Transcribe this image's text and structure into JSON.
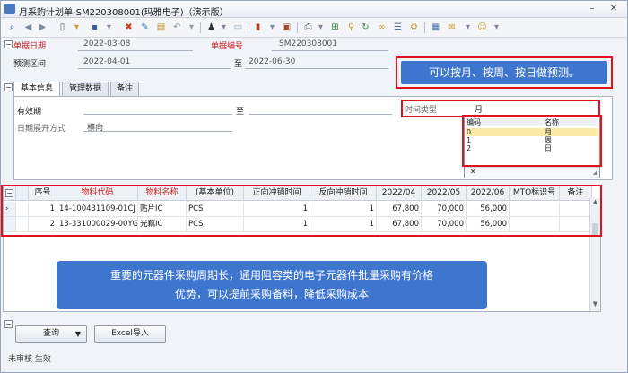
{
  "window": {
    "title": "月采购计划单-SM220308001(玛雅电子)（演示版）",
    "minimize": "–",
    "close": "✕"
  },
  "toolbar": {
    "icons": [
      "preview-icon",
      "back-icon",
      "forward-icon",
      "new-icon",
      "open-icon",
      "save-icon",
      "delete-icon",
      "edit-icon",
      "copy-icon",
      "undo-icon",
      "print-setup-icon",
      "approve-icon",
      "refresh-icon",
      "import-icon",
      "export-icon",
      "print-icon",
      "find-icon",
      "filter-icon",
      "link-icon",
      "tools-icon",
      "mail-icon",
      "chat-icon"
    ]
  },
  "header": {
    "doc_date_label": "单据日期",
    "doc_date_value": "2022-03-08",
    "doc_no_label": "单据编号",
    "doc_no_value": "SM220308001",
    "forecast_range_label": "预测区间",
    "forecast_from": "2022-04-01",
    "to_label": "至",
    "forecast_to": "2022-06-30"
  },
  "callout_top": "可以按月、按周、按日做预测。",
  "tabs": [
    {
      "label": "基本信息"
    },
    {
      "label": "管理数据"
    },
    {
      "label": "备注"
    }
  ],
  "basic": {
    "valid_label": "有效期",
    "to_label": "至",
    "expand_label": "日期展开方式",
    "expand_value": "横向",
    "time_type_label": "时间类型",
    "time_type_value": "月"
  },
  "dropdown": {
    "col_code": "编码",
    "col_name": "名称",
    "options": [
      {
        "code": "0",
        "name": "月"
      },
      {
        "code": "1",
        "name": "周"
      },
      {
        "code": "2",
        "name": "日"
      }
    ],
    "close": "✕"
  },
  "grid": {
    "columns": [
      "序号",
      "物料代码",
      "物料名称",
      "(基本单位)",
      "正向冲销时间",
      "反向冲销时间",
      "2022/04",
      "2022/05",
      "2022/06",
      "MTO标识号",
      "备注"
    ],
    "rows": [
      {
        "seq": "1",
        "code": "14-100431109-01CJ",
        "name": "贴片IC",
        "unit": "PCS",
        "fwd": "1",
        "rev": "1",
        "m04": "67,800",
        "m05": "70,000",
        "m06": "56,000",
        "mto": "",
        "note": ""
      },
      {
        "seq": "2",
        "code": "13-331000029-00YG",
        "name": "光藕IC",
        "unit": "PCS",
        "fwd": "1",
        "rev": "1",
        "m04": "67,800",
        "m05": "70,000",
        "m06": "56,000",
        "mto": "",
        "note": ""
      }
    ]
  },
  "callout_bottom": {
    "line1": "重要的元器件采购周期长，通用阻容类的电子元器件批量采购有价格",
    "line2": "优势，可以提前采购备料，降低采购成本"
  },
  "buttons": {
    "query": "查询",
    "query_arrow": "▼",
    "excel_import": "Excel导入"
  },
  "status": "未审核 生效",
  "colors": {
    "accent_blue": "#3e76cf",
    "highlight_red": "#e0131b",
    "selected_row": "#fbe9a8"
  }
}
